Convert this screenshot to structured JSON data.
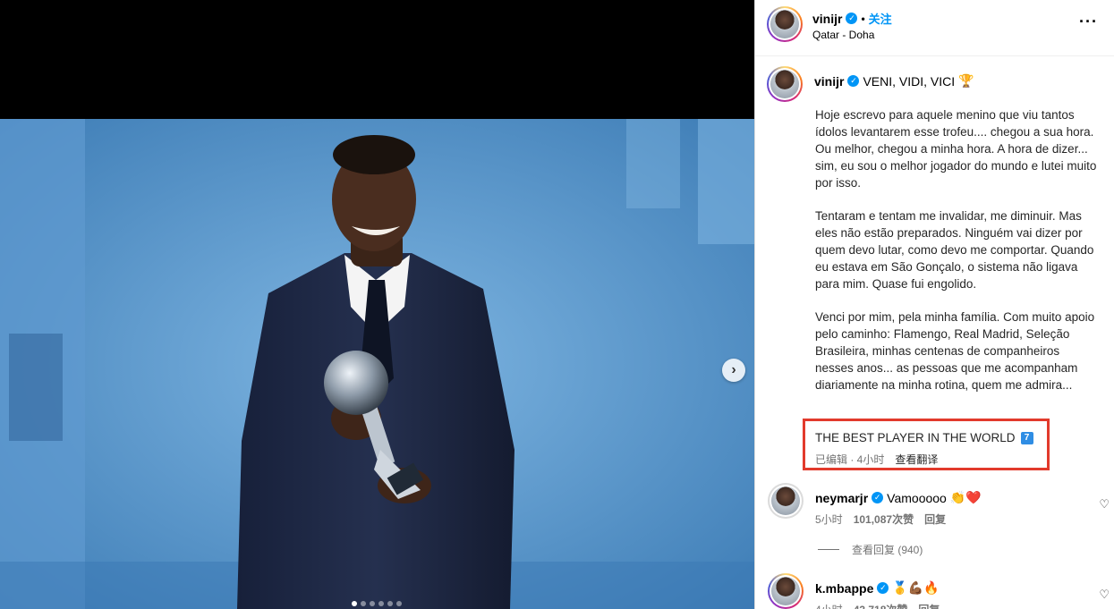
{
  "post": {
    "username": "vinijr",
    "follow_label": "关注",
    "location": "Qatar - Doha",
    "more_icon": "more-icon",
    "caption_title": "VENI, VIDI, VICI",
    "caption_title_emoji": "🏆",
    "caption_paragraphs": [
      "Hoje escrevo para aquele menino que viu tantos ídolos levantarem esse trofeu.... chegou a sua hora. Ou melhor, chegou a minha hora. A hora de dizer... sim, eu sou o melhor jogador do mundo e lutei muito por isso.",
      "Tentaram e tentam me invalidar, me diminuir. Mas eles não estão preparados. Ninguém vai dizer por quem devo lutar, como devo me comportar. Quando eu estava em São Gonçalo, o sistema não ligava para mim. Quase fui engolido.",
      "Venci por mim, pela minha família. Com muito apoio pelo caminho: Flamengo, Real Madrid, Seleção Brasileira, minhas centenas de companheiros nesses anos... as pessoas que me acompanham diariamente na minha rotina, quem me admira..."
    ],
    "best_line": "THE BEST PLAYER IN THE WORLD",
    "best_emoji": "7",
    "edited": "已编辑 · 4小时",
    "translate": "查看翻译"
  },
  "comments": [
    {
      "username": "neymarjr",
      "text": "Vamooooo",
      "emoji": "👏❤️",
      "time": "5小时",
      "likes": "101,087次赞",
      "reply": "回复",
      "view_replies": "查看回复 (940)"
    },
    {
      "username": "k.mbappe",
      "text": "",
      "emoji": "🥇💪🏾🔥",
      "time": "4小时",
      "likes": "43,718次赞",
      "reply": "回复"
    }
  ],
  "carousel": {
    "total_dots": 6,
    "active_dot": 0
  },
  "colors": {
    "accent": "#0095f6",
    "highlight": "#e23a2c"
  }
}
